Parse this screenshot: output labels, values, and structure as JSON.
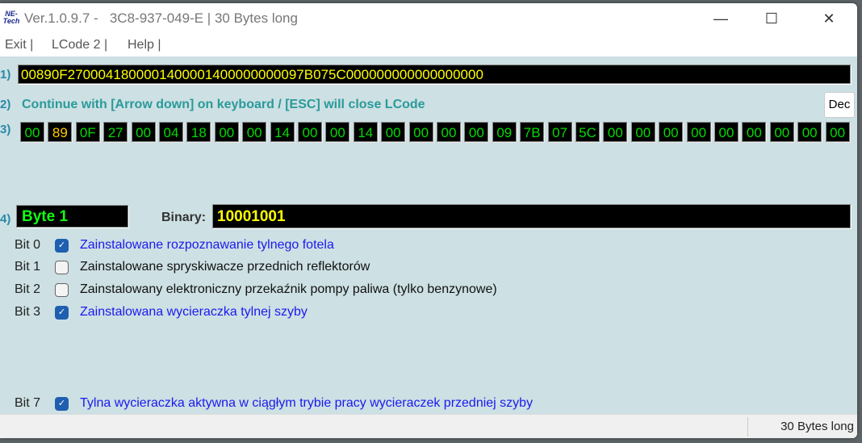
{
  "window": {
    "logo": "NE-Tech",
    "title": "Ver.1.0.9.7 -   3C8-937-049-E | 30 Bytes long",
    "minimize": "—",
    "maximize": "☐",
    "close": "✕"
  },
  "menu": [
    "Exit |",
    "LCode 2 |",
    "Help |"
  ],
  "row_labels": [
    "1)",
    "2)",
    "3)",
    "4)"
  ],
  "hex_string": "00890F2700041800001400001400000000097B075C000000000000000000",
  "hint": "Continue with [Arrow down] on keyboard / [ESC] will close LCode",
  "dec_button": "Dec",
  "bytes": [
    "00",
    "89",
    "0F",
    "27",
    "00",
    "04",
    "18",
    "00",
    "00",
    "14",
    "00",
    "00",
    "14",
    "00",
    "00",
    "00",
    "00",
    "09",
    "7B",
    "07",
    "5C",
    "00",
    "00",
    "00",
    "00",
    "00",
    "00",
    "00",
    "00",
    "00"
  ],
  "selected_byte_index": 1,
  "byte_label": "Byte 1",
  "binary_label": "Binary:",
  "binary_value": "10001001",
  "bits": [
    {
      "label": "Bit 0",
      "text": "Zainstalowane rozpoznawanie tylnego fotela",
      "checked": true
    },
    {
      "label": "Bit 1",
      "text": "Zainstalowane spryskiwacze przednich reflektorów",
      "checked": false
    },
    {
      "label": "Bit 2",
      "text": "Zainstalowany elektroniczny przekaźnik pompy paliwa (tylko benzynowe)",
      "checked": false
    },
    {
      "label": "Bit 3",
      "text": "Zainstalowana wycieraczka tylnej szyby",
      "checked": true
    },
    {
      "label": "Bit 7",
      "text": "Tylna wycieraczka aktywna w ciągłym trybie pracy wycieraczek przedniej szyby",
      "checked": true
    }
  ],
  "status": "30 Bytes long"
}
